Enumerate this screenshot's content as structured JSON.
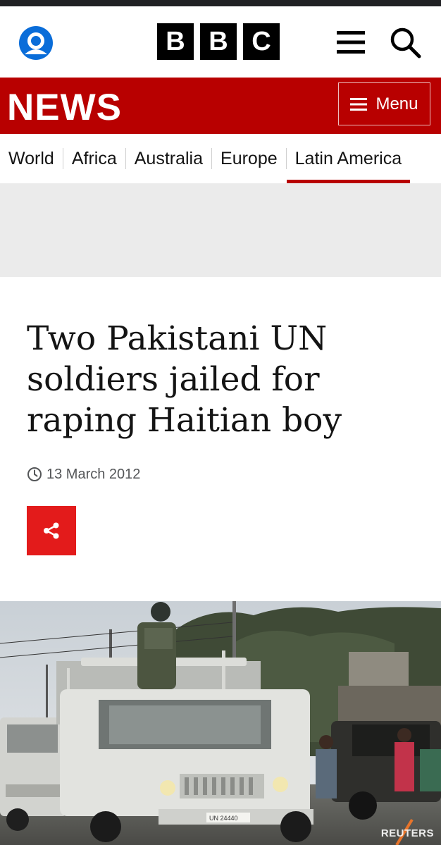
{
  "header": {
    "logo_letters": [
      "B",
      "B",
      "C"
    ],
    "account_icon": "account-icon",
    "menu_icon": "hamburger-icon",
    "search_icon": "search-icon"
  },
  "newsbar": {
    "title": "NEWS",
    "menu_label": "Menu",
    "background": "#b80000"
  },
  "nav": {
    "items": [
      {
        "label": "World"
      },
      {
        "label": "Africa"
      },
      {
        "label": "Australia"
      },
      {
        "label": "Europe"
      },
      {
        "label": "Latin America",
        "active": true
      }
    ]
  },
  "article": {
    "headline": "Two Pakistani UN soldiers jailed for raping Haitian boy",
    "date": "13 March 2012",
    "share_icon": "share-icon",
    "share_color": "#e31b1b"
  },
  "photo": {
    "credit": "REUTERS",
    "vehicle_plate": "UN 24440"
  }
}
